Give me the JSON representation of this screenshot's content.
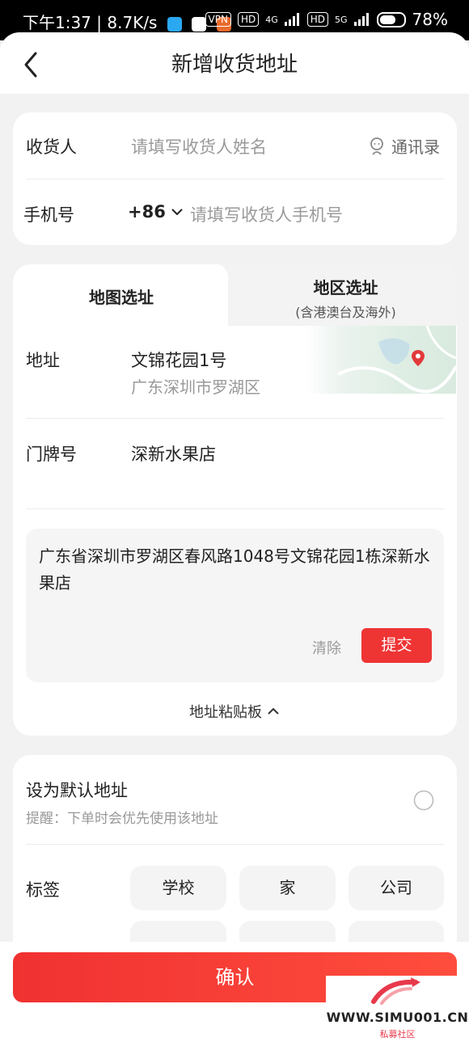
{
  "statusbar": {
    "time": "下午1:37",
    "speed": "8.7K/s",
    "vpn": "VPN",
    "hd1": "HD",
    "net1": "4G",
    "hd2": "HD",
    "net2": "5G",
    "battery": "78%",
    "battery_level": 0.78
  },
  "header": {
    "title": "新增收货地址"
  },
  "contact": {
    "recipient_label": "收货人",
    "recipient_placeholder": "请填写收货人姓名",
    "contacts_button": "通讯录",
    "phone_label": "手机号",
    "country_code": "+86",
    "phone_placeholder": "请填写收货人手机号"
  },
  "address": {
    "tab_map": "地图选址",
    "tab_region": "地区选址",
    "tab_region_sub": "(含港澳台及海外)",
    "address_label": "地址",
    "address_name": "文锦花园1号",
    "address_area": "广东深圳市罗湖区",
    "door_label": "门牌号",
    "door_value": "深新水果店",
    "paste_text": "广东省深圳市罗湖区春风路1048号文锦花园1栋深新水果店",
    "clear_button": "清除",
    "submit_button": "提交",
    "clipboard_toggle": "地址粘贴板"
  },
  "settings": {
    "default_label": "设为默认地址",
    "default_hint": "提醒：下单时会优先使用该地址",
    "tag_label": "标签",
    "tags": [
      "学校",
      "家",
      "公司"
    ]
  },
  "footer": {
    "confirm_button": "确认"
  },
  "watermark": {
    "site": "WWW.SIMU001.CN",
    "name": "私募社区"
  },
  "colors": {
    "accent": "#ef3434",
    "background": "#f2f2f2"
  }
}
